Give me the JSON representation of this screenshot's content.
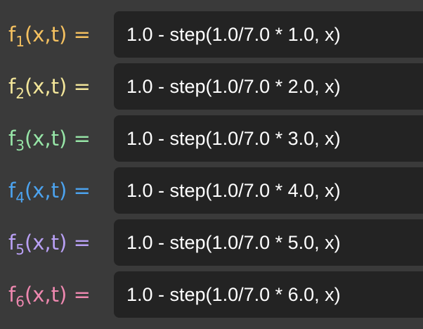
{
  "rows": [
    {
      "fn": "f",
      "sub": "1",
      "args": "(x,t)",
      "eq": "=",
      "color": "#f5c160",
      "expr": "1.0 - step(1.0/7.0 * 1.0, x)"
    },
    {
      "fn": "f",
      "sub": "2",
      "args": "(x,t)",
      "eq": "=",
      "color": "#f3e69a",
      "expr": "1.0 - step(1.0/7.0 * 2.0, x)"
    },
    {
      "fn": "f",
      "sub": "3",
      "args": "(x,t)",
      "eq": "=",
      "color": "#97e5a7",
      "expr": "1.0 - step(1.0/7.0 * 3.0, x)"
    },
    {
      "fn": "f",
      "sub": "4",
      "args": "(x,t)",
      "eq": "=",
      "color": "#4ca3ef",
      "expr": "1.0 - step(1.0/7.0 * 4.0, x)"
    },
    {
      "fn": "f",
      "sub": "5",
      "args": "(x,t)",
      "eq": "=",
      "color": "#b9a0f5",
      "expr": "1.0 - step(1.0/7.0 * 5.0, x)"
    },
    {
      "fn": "f",
      "sub": "6",
      "args": "(x,t)",
      "eq": "=",
      "color": "#ef88b0",
      "expr": "1.0 - step(1.0/7.0 * 6.0, x)"
    }
  ]
}
